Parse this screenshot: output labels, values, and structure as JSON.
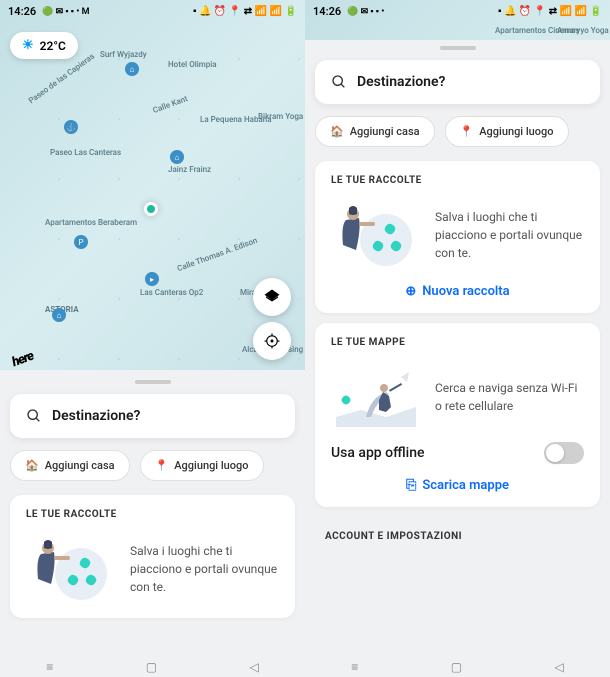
{
  "status": {
    "time": "14:26"
  },
  "weather": {
    "temp": "22°C"
  },
  "search": {
    "placeholder": "Destinazione?"
  },
  "chips": {
    "home": "Aggiungi casa",
    "place": "Aggiungi luogo"
  },
  "collections": {
    "title": "LE TUE RACCOLTE",
    "text": "Salva i luoghi che ti piacciono e portali ovunque con te.",
    "action": "Nuova raccolta"
  },
  "maps": {
    "title": "LE TUE MAPPE",
    "text": "Cerca e naviga senza Wi-Fi o rete cellulare",
    "offline_label": "Usa app offline",
    "action": "Scarica mappe"
  },
  "account": {
    "title": "ACCOUNT E IMPOSTAZIONI"
  },
  "map_pois": {
    "surf": "Surf Wyjazdy",
    "olimpia": "Hotel Olimpia",
    "kant": "Calle Kant",
    "habana": "La Pequena Habana",
    "bikram": "Bikram Yoga",
    "canteras": "Paseo Las Canteras",
    "capieras": "Paseo de las Capieras",
    "jainz": "Jainz Frainz",
    "beraber": "Apartamentos Beraberam",
    "edison": "Calle Thomas A. Edison",
    "op2": "Las Canteras Op2",
    "mirafondo": "Mirafondo",
    "astoria": "ASTORIA",
    "alcatraz": "Alcatraz Cruising Bar",
    "cinemas": "Apartamentos Cinemas",
    "amary": "Amaryyo Yoga"
  },
  "logo": "here"
}
